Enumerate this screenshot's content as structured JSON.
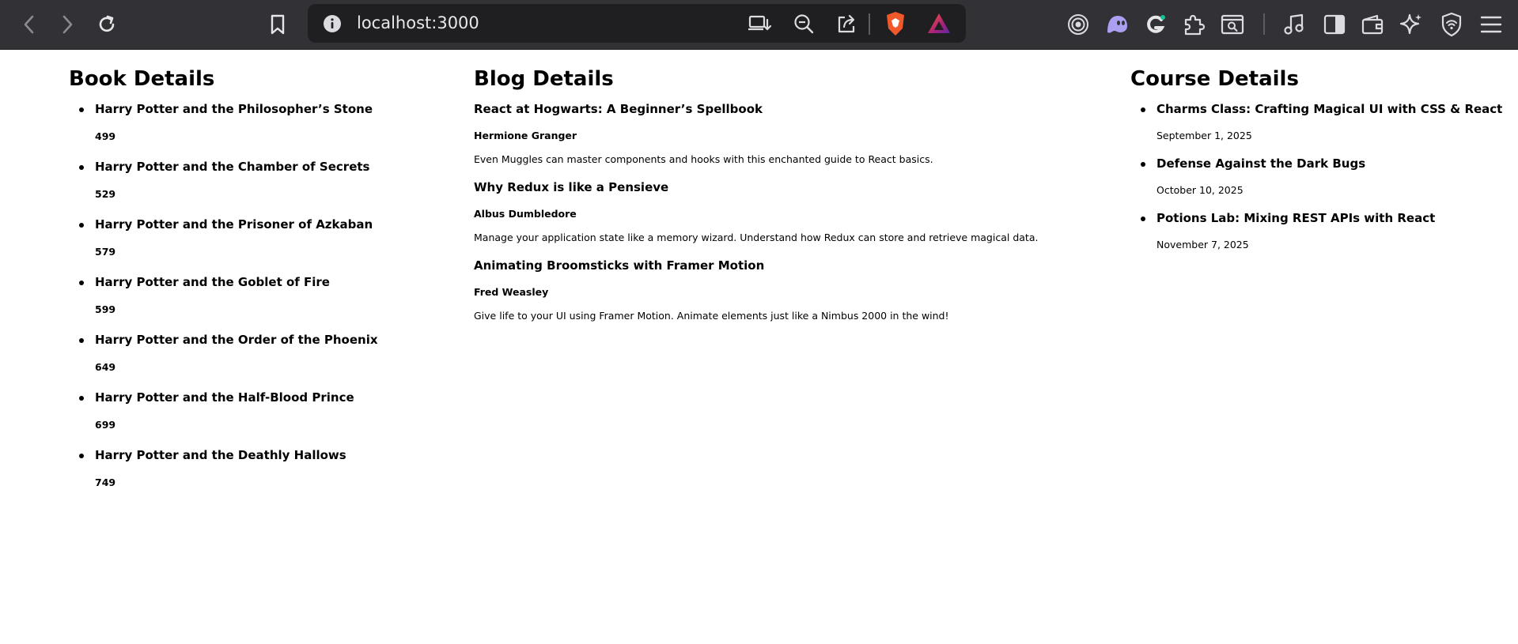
{
  "browser": {
    "url": "localhost:3000",
    "nav_icons": [
      "back-arrow-icon",
      "forward-arrow-icon",
      "reload-icon",
      "bookmark-icon"
    ],
    "omnibox_icons": [
      "site-info-icon",
      "install-app-icon",
      "zoom-out-icon",
      "share-icon",
      "brave-shields-icon",
      "brave-rewards-icon"
    ],
    "extension_icons": [
      "tor-icon",
      "ghost-extension-icon",
      "grammarly-icon",
      "extensions-puzzle-icon",
      "tab-search-icon",
      "media-music-icon",
      "sidebar-icon",
      "wallet-icon",
      "leo-ai-icon",
      "vpn-shield-icon",
      "menu-icon"
    ]
  },
  "books": {
    "heading": "Book Details",
    "items": [
      {
        "title": "Harry Potter and the Philosopher’s Stone",
        "price": "499"
      },
      {
        "title": "Harry Potter and the Chamber of Secrets",
        "price": "529"
      },
      {
        "title": "Harry Potter and the Prisoner of Azkaban",
        "price": "579"
      },
      {
        "title": "Harry Potter and the Goblet of Fire",
        "price": "599"
      },
      {
        "title": "Harry Potter and the Order of the Phoenix",
        "price": "649"
      },
      {
        "title": "Harry Potter and the Half-Blood Prince",
        "price": "699"
      },
      {
        "title": "Harry Potter and the Deathly Hallows",
        "price": "749"
      }
    ]
  },
  "blogs": {
    "heading": "Blog Details",
    "items": [
      {
        "title": "React at Hogwarts: A Beginner’s Spellbook",
        "author": "Hermione Granger",
        "description": "Even Muggles can master components and hooks with this enchanted guide to React basics."
      },
      {
        "title": "Why Redux is like a Pensieve",
        "author": "Albus Dumbledore",
        "description": "Manage your application state like a memory wizard. Understand how Redux can store and retrieve magical data."
      },
      {
        "title": "Animating Broomsticks with Framer Motion",
        "author": "Fred Weasley",
        "description": "Give life to your UI using Framer Motion. Animate elements just like a Nimbus 2000 in the wind!"
      }
    ]
  },
  "courses": {
    "heading": "Course Details",
    "items": [
      {
        "title": "Charms Class: Crafting Magical UI with CSS & React",
        "date": "September 1, 2025"
      },
      {
        "title": "Defense Against the Dark Bugs",
        "date": "October 10, 2025"
      },
      {
        "title": "Potions Lab: Mixing REST APIs with React",
        "date": "November 7, 2025"
      }
    ]
  },
  "colors": {
    "toolbar_bg": "#323236",
    "omnibox_bg": "#1f1f22",
    "page_bg": "#ffffff",
    "text": "#000000"
  }
}
